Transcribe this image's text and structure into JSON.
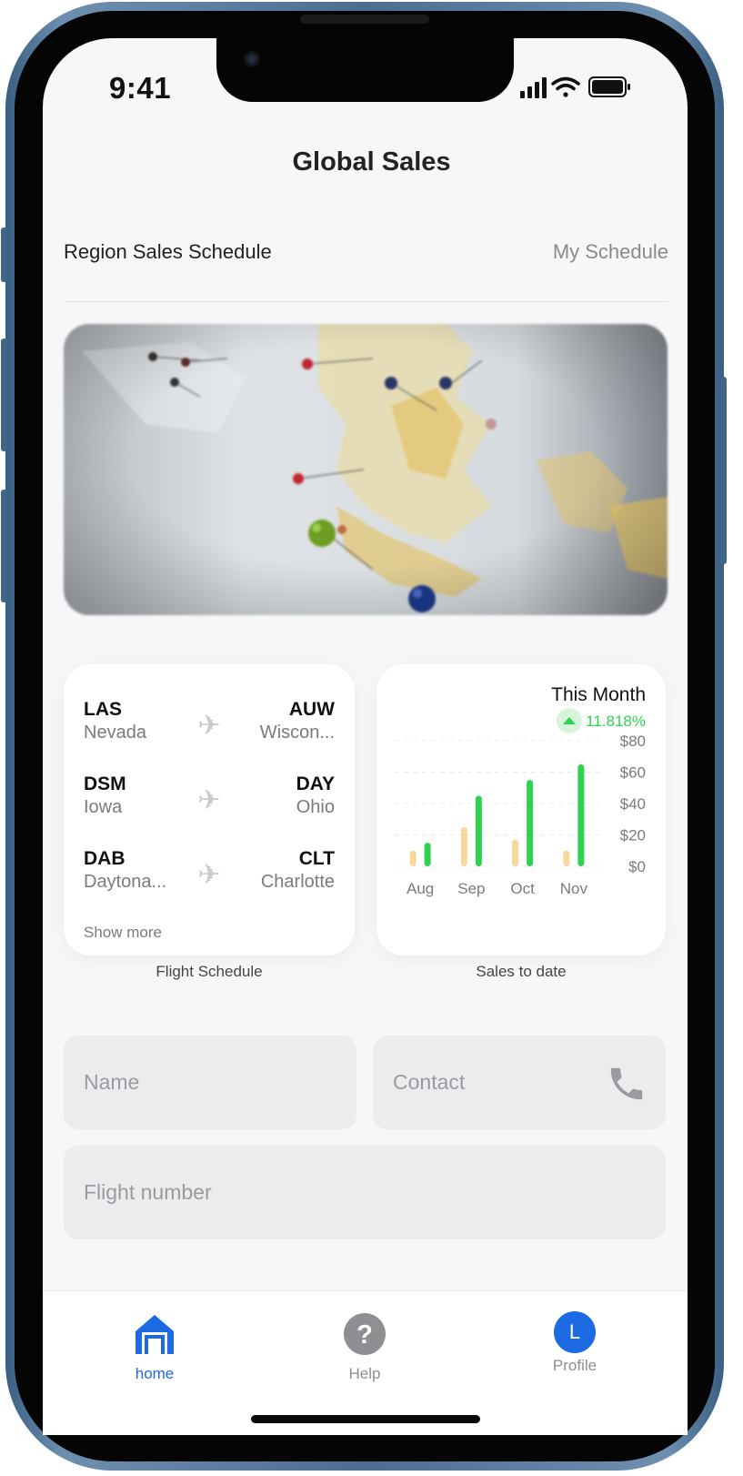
{
  "status_bar": {
    "time": "9:41"
  },
  "header": {
    "title": "Global Sales"
  },
  "segment": {
    "left_label": "Region Sales Schedule",
    "right_label": "My Schedule"
  },
  "flight_card": {
    "routes": [
      {
        "from_code": "LAS",
        "from_city": "Nevada",
        "to_code": "AUW",
        "to_city": "Wiscon..."
      },
      {
        "from_code": "DSM",
        "from_city": "Iowa",
        "to_code": "DAY",
        "to_city": "Ohio"
      },
      {
        "from_code": "DAB",
        "from_city": "Daytona...",
        "to_code": "CLT",
        "to_city": "Charlotte"
      }
    ],
    "show_more": "Show more",
    "caption": "Flight Schedule"
  },
  "sales_card": {
    "title": "This Month",
    "change": "11.818%",
    "caption": "Sales to date",
    "colors": {
      "current": "#2ed24f",
      "previous": "#f8d89a",
      "change": "#2ed24f"
    }
  },
  "chart_data": {
    "type": "bar",
    "categories": [
      "Aug",
      "Sep",
      "Oct",
      "Nov"
    ],
    "series": [
      {
        "values": [
          10,
          25,
          17,
          10
        ]
      },
      {
        "values": [
          15,
          45,
          55,
          65
        ]
      }
    ],
    "ylim": [
      0,
      80
    ],
    "yticks": [
      "$80",
      "$60",
      "$40",
      "$20",
      "$0"
    ],
    "grid": true
  },
  "form": {
    "name_placeholder": "Name",
    "contact_placeholder": "Contact",
    "flight_placeholder": "Flight number",
    "contact_icon": "phone-icon"
  },
  "tabbar": {
    "home_label": "home",
    "help_label": "Help",
    "profile_label": "Profile",
    "profile_initial": "L",
    "active_color": "#1d6ae5"
  }
}
